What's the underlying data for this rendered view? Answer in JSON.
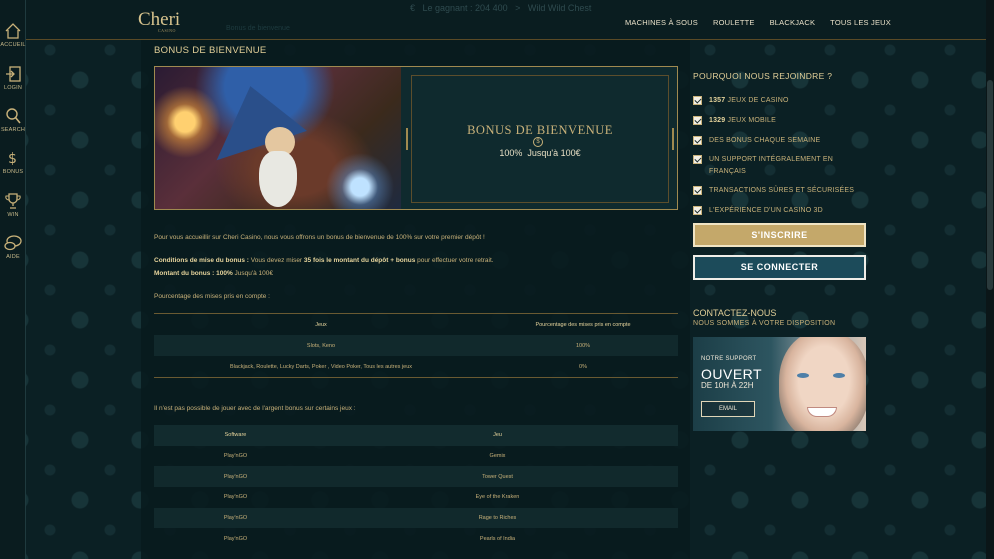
{
  "sidebar": {
    "items": [
      {
        "label": "ACCUEIL",
        "icon": "home-icon"
      },
      {
        "label": "LOGIN",
        "icon": "login-icon"
      },
      {
        "label": "SEARCH",
        "icon": "search-icon"
      },
      {
        "label": "BONUS",
        "icon": "bonus-icon"
      },
      {
        "label": "WIN",
        "icon": "trophy-icon"
      },
      {
        "label": "AIDE",
        "icon": "chat-icon"
      }
    ]
  },
  "header": {
    "logo": "Cheri",
    "logo_sub": "CASINO",
    "faded_banner": "€   Le gagnant : 204 400   >   Wild Wild Chest",
    "faded_sub": "Bonus de bienvenue",
    "nav": [
      "MACHINES À SOUS",
      "ROULETTE",
      "BLACKJACK",
      "TOUS LES JEUX"
    ]
  },
  "main": {
    "title": "BONUS DE BIENVENUE",
    "banner": {
      "heading": "BONUS DE BIENVENUE",
      "coin": "$",
      "sub": "100%  Jusqu'à 100€"
    },
    "intro": "Pour vous accueillir sur Cheri Casino, nous vous offrons un bonus de bienvenue de 100% sur votre premier dépôt !",
    "conditions_label": "Conditions de mise du bonus :",
    "conditions_text": " Vous devez miser ",
    "conditions_bold": "35 fois le montant du dépôt + bonus",
    "conditions_tail": " pour effectuer votre retrait.",
    "amount_label": "Montant du bonus : 100%",
    "amount_tail": " Jusqu'à 100€",
    "pct_label": "Pourcentage des mises pris en compte :",
    "table1": {
      "headers": [
        "Jeux",
        "Pourcentage des mises pris en compte"
      ],
      "rows": [
        [
          "Slots, Keno",
          "100%"
        ],
        [
          "Blackjack, Roulette, Lucky Darts, Poker , Video Poker, Tous les autres jeux",
          "0%"
        ]
      ]
    },
    "restricted_label": "Il n'est pas possible de jouer avec de l'argent bonus sur certains jeux :",
    "table2": {
      "headers": [
        "Software",
        "Jeu"
      ],
      "rows": [
        [
          "Play'nGO",
          "Gemix"
        ],
        [
          "Play'nGO",
          "Tower Quest"
        ],
        [
          "Play'nGO",
          "Eye of the Kraken"
        ],
        [
          "Play'nGO",
          "Rage to Riches"
        ],
        [
          "Play'nGO",
          "Pearls of India"
        ]
      ]
    }
  },
  "right": {
    "why_title": "POURQUOI NOUS REJOINDRE ?",
    "benefits": [
      {
        "bold": "1357",
        "text": " JEUX DE CASINO"
      },
      {
        "bold": "1329",
        "text": " JEUX MOBILE"
      },
      {
        "bold": "",
        "text": "DES BONUS CHAQUE SEMAINE"
      },
      {
        "bold": "",
        "text": "UN SUPPORT INTÉGRALEMENT EN FRANÇAIS"
      },
      {
        "bold": "",
        "text": "TRANSACTIONS SÛRES ET SÉCURISÉES"
      },
      {
        "bold": "",
        "text": "L'EXPÉRIENCE D'UN CASINO 3D"
      }
    ],
    "signup_label": "S'INSCRIRE",
    "login_label": "SE CONNECTER",
    "contact_title": "CONTACTEZ-NOUS",
    "contact_sub": "NOUS SOMMES À VOTRE DISPOSITION",
    "support": {
      "small": "NOTRE SUPPORT",
      "big": "OUVERT",
      "hours": "DE 10H À 22H",
      "email_label": "EMAIL"
    }
  },
  "colors": {
    "accent_gold": "#c9b27a",
    "signup_bg": "#c4a86a",
    "login_bg": "#1c4b5a",
    "page_bg": "#0b2024"
  }
}
